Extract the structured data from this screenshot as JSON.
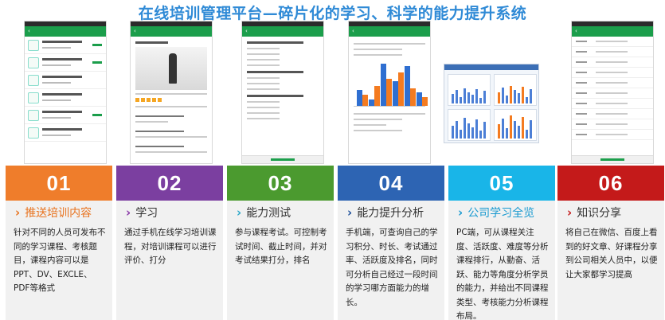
{
  "page": {
    "title": "在线培训管理平台—碎片化的学习、科学的能力提升系统"
  },
  "colors": {
    "title": "#2f8ad6",
    "app_green": "#1b9e4b",
    "chart_blue": "#2f6fd1",
    "chart_orange": "#f47b20"
  },
  "chart_data": {
    "type": "bar",
    "series": [
      {
        "values": [
          0.35,
          0.15,
          0.95,
          0.55,
          0.9,
          0.3
        ]
      },
      {
        "values": [
          0.25,
          0.45,
          0.6,
          0.75,
          0.4,
          0.2
        ]
      }
    ]
  },
  "cards": [
    {
      "num": "01",
      "title": "推送培训内容",
      "desc": "针对不同的人员可发布不同的学习课程、考核题目，课程内容可以是PPT、DV、EXCLE、PDF等格式",
      "band_color": "#ef7d2b",
      "title_color": "#e8731f",
      "chev_color": "#e8731f"
    },
    {
      "num": "02",
      "title": "学习",
      "desc": "通过手机在线学习培训课程，对培训课程可以进行评价、打分",
      "band_color": "#7b3fa0",
      "title_color": "#333333",
      "chev_color": "#8a3aa8"
    },
    {
      "num": "03",
      "title": "能力测试",
      "desc": "参与课程考试。可控制考试时间、截止时间，并对考试结果打分，排名",
      "band_color": "#4b9a2f",
      "title_color": "#333333",
      "chev_color": "#2aa7c9"
    },
    {
      "num": "04",
      "title": "能力提升分析",
      "desc": "手机端，可查询自己的学习积分、时长、考试通过率、活跃度及排名，同时可分析自己经过一段时间的学习哪方面能力的增长。",
      "band_color": "#2d64b3",
      "title_color": "#333333",
      "chev_color": "#1d4f9a"
    },
    {
      "num": "05",
      "title": "公司学习全览",
      "desc": "PC端，可从课程关注度、活跃度、难度等分析课程排行，从勤奋、活跃、能力等角度分析学员的能力，并给出不同课程类型、考核能力分析课程布局。",
      "band_color": "#19b5e8",
      "title_color": "#1a9ad0",
      "chev_color": "#1a9ad0"
    },
    {
      "num": "06",
      "title": "知识分享",
      "desc": "将自己在微信、百度上看到的好文章、好课程分享到公司相关人员中，以便让大家都学习提高",
      "band_color": "#c41a1a",
      "title_color": "#333333",
      "chev_color": "#c41a1a"
    }
  ]
}
